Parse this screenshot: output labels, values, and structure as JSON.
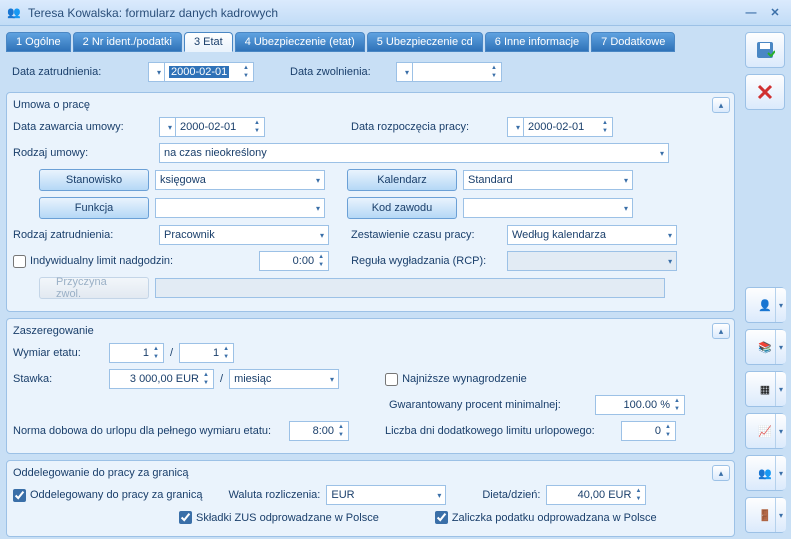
{
  "window": {
    "title": "Teresa Kowalska: formularz danych kadrowych"
  },
  "tabs": [
    {
      "label": "1 Ogólne"
    },
    {
      "label": "2 Nr ident./podatki"
    },
    {
      "label": "3 Etat"
    },
    {
      "label": "4 Ubezpieczenie (etat)"
    },
    {
      "label": "5 Ubezpieczenie cd"
    },
    {
      "label": "6 Inne informacje"
    },
    {
      "label": "7 Dodatkowe"
    }
  ],
  "top": {
    "data_zatrudnienia_label": "Data zatrudnienia:",
    "data_zatrudnienia_value": "2000-02-01",
    "data_zwolnienia_label": "Data zwolnienia:",
    "data_zwolnienia_value": ""
  },
  "umowa": {
    "title": "Umowa o pracę",
    "data_zawarcia_label": "Data zawarcia umowy:",
    "data_zawarcia_value": "2000-02-01",
    "data_rozpoczecia_label": "Data rozpoczęcia pracy:",
    "data_rozpoczecia_value": "2000-02-01",
    "rodzaj_umowy_label": "Rodzaj umowy:",
    "rodzaj_umowy_value": "na czas nieokreślony",
    "stanowisko_btn": "Stanowisko",
    "stanowisko_value": "księgowa",
    "funkcja_btn": "Funkcja",
    "funkcja_value": "",
    "kalendarz_btn": "Kalendarz",
    "kalendarz_value": "Standard",
    "kod_zawodu_btn": "Kod zawodu",
    "kod_zawodu_value": "",
    "rodzaj_zatrudnienia_label": "Rodzaj zatrudnienia:",
    "rodzaj_zatrudnienia_value": "Pracownik",
    "zestawienie_label": "Zestawienie czasu pracy:",
    "zestawienie_value": "Według kalendarza",
    "indyw_limit_label": "Indywidualny limit nadgodzin:",
    "indyw_limit_value": "0:00",
    "regula_label": "Reguła wygładzania (RCP):",
    "regula_value": "",
    "przyczyna_btn": "Przyczyna zwol.",
    "przyczyna_value": ""
  },
  "zasz": {
    "title": "Zaszeregowanie",
    "wymiar_label": "Wymiar etatu:",
    "wymiar_num": "1",
    "wymiar_den": "1",
    "stawka_label": "Stawka:",
    "stawka_value": "3 000,00 EUR",
    "stawka_per": "miesiąc",
    "najnizsze_label": "Najniższe wynagrodzenie",
    "gwarant_label": "Gwarantowany procent minimalnej:",
    "gwarant_value": "100.00 %",
    "norma_label": "Norma dobowa do urlopu dla pełnego wymiaru etatu:",
    "norma_value": "8:00",
    "liczba_dni_label": "Liczba dni dodatkowego limitu urlopowego:",
    "liczba_dni_value": "0",
    "slash": "/"
  },
  "oddel": {
    "title": "Oddelegowanie do pracy za granicą",
    "chk_label": "Oddelegowany do pracy za granicą",
    "waluta_label": "Waluta rozliczenia:",
    "waluta_value": "EUR",
    "dieta_label": "Dieta/dzień:",
    "dieta_value": "40,00 EUR",
    "skladki_label": "Składki ZUS odprowadzane w Polsce",
    "zaliczka_label": "Zaliczka podatku odprowadzana w Polsce"
  }
}
